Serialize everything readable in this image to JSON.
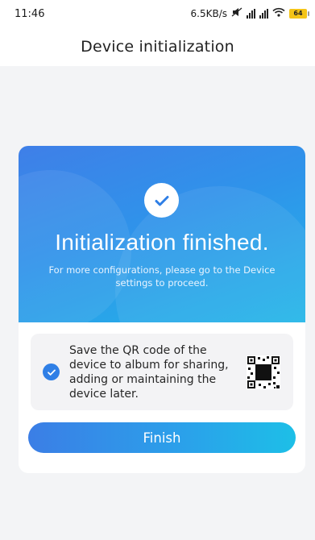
{
  "status_bar": {
    "time": "11:46",
    "network_speed": "6.5KB/s",
    "battery_level": "64"
  },
  "header": {
    "title": "Device initialization"
  },
  "result_card": {
    "title": "Initialization finished.",
    "subtitle": "For more configurations, please go to the Device settings to proceed.",
    "save_qr": {
      "checked": true,
      "text": "Save the QR code of the device to album for sharing, adding or maintaining the device later."
    },
    "finish_label": "Finish"
  },
  "colors": {
    "accent": "#2f7fe6",
    "hero_start": "#3f7fe8",
    "hero_end": "#23b6e8"
  },
  "icons": [
    "check-icon",
    "qr-code-icon",
    "wifi-icon",
    "signal-icon",
    "battery-icon",
    "mute-icon"
  ]
}
